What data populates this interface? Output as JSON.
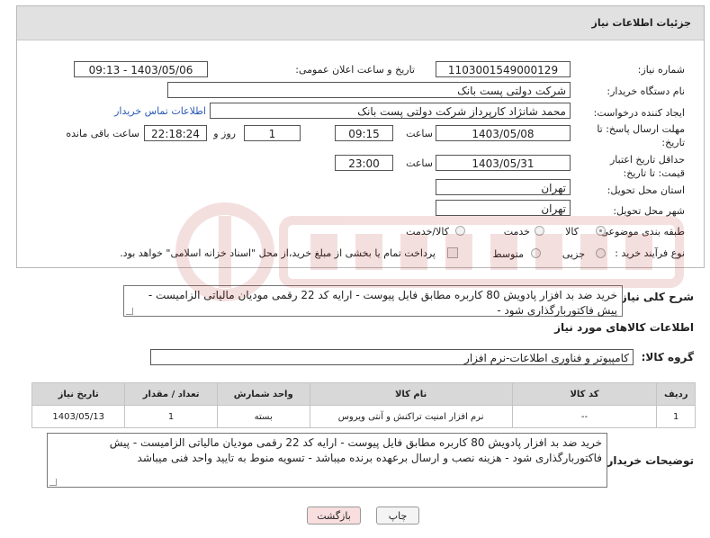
{
  "header": {
    "title": "جزئیات اطلاعات نیاز"
  },
  "fields": {
    "need_number_label": "شماره نیاز:",
    "need_number": "1103001549000129",
    "announce_label": "تاریخ و ساعت اعلان عمومی:",
    "announce_value": "1403/05/06 - 09:13",
    "buyer_org_label": "نام دستگاه خریدار:",
    "buyer_org": "شرکت دولتی پست بانک",
    "creator_label": "ایجاد کننده درخواست:",
    "creator": "محمد شانژاد کارپرداز شرکت دولتی پست بانک",
    "contact_link": "اطلاعات تماس خریدار",
    "deadline_label": "مهلت ارسال پاسخ: تا تاریخ:",
    "deadline_date": "1403/05/08",
    "time_word": "ساعت",
    "deadline_time": "09:15",
    "days_value": "1",
    "days_word": "روز و",
    "remaining_time": "22:18:24",
    "remaining_label": "ساعت باقی مانده",
    "validity_label": "حداقل تاریخ اعتبار قیمت: تا تاریخ:",
    "validity_date": "1403/05/31",
    "validity_time": "23:00",
    "province_label": "استان محل تحویل:",
    "province": "تهران",
    "city_label": "شهر محل تحویل:",
    "city": "تهران",
    "category_label": "طبقه بندی موضوعی:",
    "category_goods": "کالا",
    "category_service": "خدمت",
    "category_both": "کالا/خدمت",
    "purchase_type_label": "نوع فرآیند خرید :",
    "purchase_minor": "جزیی",
    "purchase_medium": "متوسط",
    "payment_note": "پرداخت تمام یا بخشی از مبلغ خرید،از محل \"اسناد خزانه اسلامی\" خواهد بود."
  },
  "description": {
    "label": "شرح کلی نیاز:",
    "text": "خرید ضد بد افزار پادویش 80 کاربره مطابق فایل پیوست - ارایه کد 22 رقمی مودیان مالیاتی الزامیست - پیش فاکتوربارگذاری شود -"
  },
  "goods_section": {
    "title": "اطلاعات کالاهای مورد نیاز",
    "group_label": "گروه کالا:",
    "group_value": "کامپیوتر و فناوری اطلاعات-نرم افزار"
  },
  "table": {
    "headers": [
      "ردیف",
      "کد کالا",
      "نام کالا",
      "واحد شمارش",
      "تعداد / مقدار",
      "تاریخ نیاز"
    ],
    "rows": [
      [
        "1",
        "--",
        "نرم افزار امنیت تراکنش و آنتی ویروس",
        "بسته",
        "1",
        "1403/05/13"
      ]
    ]
  },
  "buyer_notes": {
    "label": "توضیحات خریدار:",
    "text": "خرید ضد بد افزار پادویش 80 کاربره مطابق فایل پیوست - ارایه کد 22 رقمی مودیان مالیاتی الزامیست - پیش فاکتوربارگذاری شود - هزینه نصب و ارسال برعهده برنده میباشد - تسویه منوط به تایید  واحد فنی میباشد"
  },
  "buttons": {
    "print": "چاپ",
    "back": "بازگشت"
  },
  "colors": {
    "link": "#2a59b5",
    "back_button_bg": "#f8dede",
    "header_bg": "#e1e1e1"
  }
}
